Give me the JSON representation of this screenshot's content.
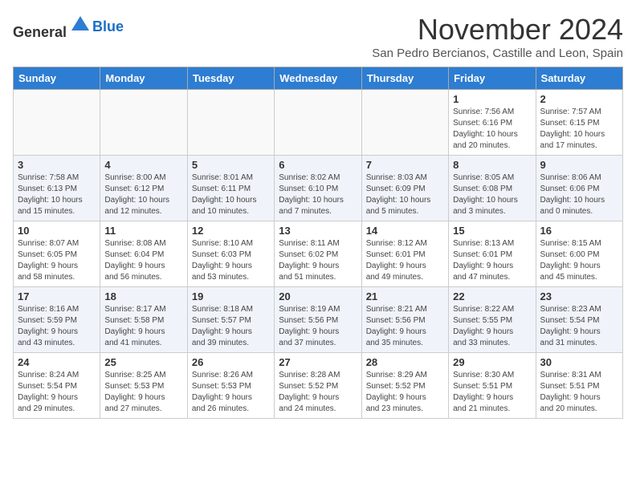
{
  "header": {
    "logo_general": "General",
    "logo_blue": "Blue",
    "title": "November 2024",
    "subtitle": "San Pedro Bercianos, Castille and Leon, Spain"
  },
  "weekdays": [
    "Sunday",
    "Monday",
    "Tuesday",
    "Wednesday",
    "Thursday",
    "Friday",
    "Saturday"
  ],
  "weeks": [
    {
      "days": [
        {
          "num": "",
          "info": ""
        },
        {
          "num": "",
          "info": ""
        },
        {
          "num": "",
          "info": ""
        },
        {
          "num": "",
          "info": ""
        },
        {
          "num": "",
          "info": ""
        },
        {
          "num": "1",
          "info": "Sunrise: 7:56 AM\nSunset: 6:16 PM\nDaylight: 10 hours\nand 20 minutes."
        },
        {
          "num": "2",
          "info": "Sunrise: 7:57 AM\nSunset: 6:15 PM\nDaylight: 10 hours\nand 17 minutes."
        }
      ]
    },
    {
      "days": [
        {
          "num": "3",
          "info": "Sunrise: 7:58 AM\nSunset: 6:13 PM\nDaylight: 10 hours\nand 15 minutes."
        },
        {
          "num": "4",
          "info": "Sunrise: 8:00 AM\nSunset: 6:12 PM\nDaylight: 10 hours\nand 12 minutes."
        },
        {
          "num": "5",
          "info": "Sunrise: 8:01 AM\nSunset: 6:11 PM\nDaylight: 10 hours\nand 10 minutes."
        },
        {
          "num": "6",
          "info": "Sunrise: 8:02 AM\nSunset: 6:10 PM\nDaylight: 10 hours\nand 7 minutes."
        },
        {
          "num": "7",
          "info": "Sunrise: 8:03 AM\nSunset: 6:09 PM\nDaylight: 10 hours\nand 5 minutes."
        },
        {
          "num": "8",
          "info": "Sunrise: 8:05 AM\nSunset: 6:08 PM\nDaylight: 10 hours\nand 3 minutes."
        },
        {
          "num": "9",
          "info": "Sunrise: 8:06 AM\nSunset: 6:06 PM\nDaylight: 10 hours\nand 0 minutes."
        }
      ]
    },
    {
      "days": [
        {
          "num": "10",
          "info": "Sunrise: 8:07 AM\nSunset: 6:05 PM\nDaylight: 9 hours\nand 58 minutes."
        },
        {
          "num": "11",
          "info": "Sunrise: 8:08 AM\nSunset: 6:04 PM\nDaylight: 9 hours\nand 56 minutes."
        },
        {
          "num": "12",
          "info": "Sunrise: 8:10 AM\nSunset: 6:03 PM\nDaylight: 9 hours\nand 53 minutes."
        },
        {
          "num": "13",
          "info": "Sunrise: 8:11 AM\nSunset: 6:02 PM\nDaylight: 9 hours\nand 51 minutes."
        },
        {
          "num": "14",
          "info": "Sunrise: 8:12 AM\nSunset: 6:01 PM\nDaylight: 9 hours\nand 49 minutes."
        },
        {
          "num": "15",
          "info": "Sunrise: 8:13 AM\nSunset: 6:01 PM\nDaylight: 9 hours\nand 47 minutes."
        },
        {
          "num": "16",
          "info": "Sunrise: 8:15 AM\nSunset: 6:00 PM\nDaylight: 9 hours\nand 45 minutes."
        }
      ]
    },
    {
      "days": [
        {
          "num": "17",
          "info": "Sunrise: 8:16 AM\nSunset: 5:59 PM\nDaylight: 9 hours\nand 43 minutes."
        },
        {
          "num": "18",
          "info": "Sunrise: 8:17 AM\nSunset: 5:58 PM\nDaylight: 9 hours\nand 41 minutes."
        },
        {
          "num": "19",
          "info": "Sunrise: 8:18 AM\nSunset: 5:57 PM\nDaylight: 9 hours\nand 39 minutes."
        },
        {
          "num": "20",
          "info": "Sunrise: 8:19 AM\nSunset: 5:56 PM\nDaylight: 9 hours\nand 37 minutes."
        },
        {
          "num": "21",
          "info": "Sunrise: 8:21 AM\nSunset: 5:56 PM\nDaylight: 9 hours\nand 35 minutes."
        },
        {
          "num": "22",
          "info": "Sunrise: 8:22 AM\nSunset: 5:55 PM\nDaylight: 9 hours\nand 33 minutes."
        },
        {
          "num": "23",
          "info": "Sunrise: 8:23 AM\nSunset: 5:54 PM\nDaylight: 9 hours\nand 31 minutes."
        }
      ]
    },
    {
      "days": [
        {
          "num": "24",
          "info": "Sunrise: 8:24 AM\nSunset: 5:54 PM\nDaylight: 9 hours\nand 29 minutes."
        },
        {
          "num": "25",
          "info": "Sunrise: 8:25 AM\nSunset: 5:53 PM\nDaylight: 9 hours\nand 27 minutes."
        },
        {
          "num": "26",
          "info": "Sunrise: 8:26 AM\nSunset: 5:53 PM\nDaylight: 9 hours\nand 26 minutes."
        },
        {
          "num": "27",
          "info": "Sunrise: 8:28 AM\nSunset: 5:52 PM\nDaylight: 9 hours\nand 24 minutes."
        },
        {
          "num": "28",
          "info": "Sunrise: 8:29 AM\nSunset: 5:52 PM\nDaylight: 9 hours\nand 23 minutes."
        },
        {
          "num": "29",
          "info": "Sunrise: 8:30 AM\nSunset: 5:51 PM\nDaylight: 9 hours\nand 21 minutes."
        },
        {
          "num": "30",
          "info": "Sunrise: 8:31 AM\nSunset: 5:51 PM\nDaylight: 9 hours\nand 20 minutes."
        }
      ]
    }
  ]
}
